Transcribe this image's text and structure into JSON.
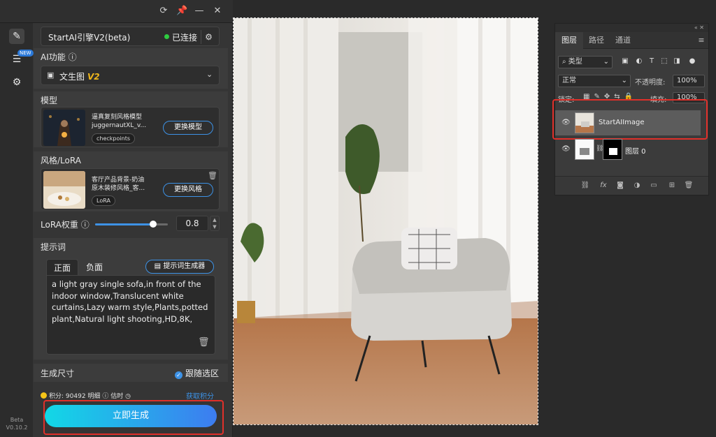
{
  "titlebar": {
    "icons": [
      "refresh-icon",
      "pin-icon",
      "minimize-icon",
      "close-icon"
    ]
  },
  "rail": {
    "items": [
      "edit-icon",
      "layers-stack-icon",
      "gear-icon"
    ],
    "new_badge": "NEW",
    "version_line1": "Beta",
    "version_line2": "V0.10.2"
  },
  "engine": {
    "name": "StartAI引擎V2(beta)",
    "status": "已连接",
    "status_color": "#2ecc40"
  },
  "ai_function": {
    "label": "AI功能",
    "selected": "文生图",
    "version_tag": "V2"
  },
  "model": {
    "label": "模型",
    "name_line1": "逼真复刻风格模型",
    "name_line2": "juggernautXL_v...",
    "tag": "checkpoints",
    "button": "更换模型"
  },
  "style": {
    "label": "风格/LoRA",
    "name_line1": "客厅产品背景-奶油",
    "name_line2": "原木装修风格_客...",
    "tag": "LoRA",
    "button": "更换风格"
  },
  "lora_weight": {
    "label": "LoRA权重",
    "value": "0.8",
    "fraction": 0.8
  },
  "prompt": {
    "label": "提示词",
    "tabs": [
      "正面",
      "负面"
    ],
    "active_tab": "正面",
    "generator_button": "提示词生成器",
    "text": "a light gray single sofa,in front of the indoor window,Translucent white curtains,Lazy warm style,Plants,potted plant,Natural light shooting,HD,8K,"
  },
  "size": {
    "label": "生成尺寸",
    "follow_selection": "跟随选区"
  },
  "credits": {
    "label": "积分:",
    "value": "90492",
    "detail": "明细",
    "estimate": "估时",
    "get_credits": "获取积分"
  },
  "generate_button": "立即生成",
  "colors": {
    "accent": "#3d92e6",
    "highlight_red": "#e0302a",
    "gen_gradient_start": "#12d8e6",
    "gen_gradient_end": "#3d7cf0"
  },
  "layers_panel": {
    "tabs": [
      "图层",
      "路径",
      "通道"
    ],
    "active_tab": "图层",
    "filter_select": "类型",
    "blend_mode": "正常",
    "opacity_label": "不透明度:",
    "opacity_value": "100%",
    "lock_label": "锁定:",
    "fill_label": "填充:",
    "fill_value": "100%",
    "layers": [
      {
        "name": "StartAIImage",
        "visible": true,
        "selected": true
      },
      {
        "name": "图层 0",
        "visible": true,
        "selected": false
      }
    ]
  }
}
